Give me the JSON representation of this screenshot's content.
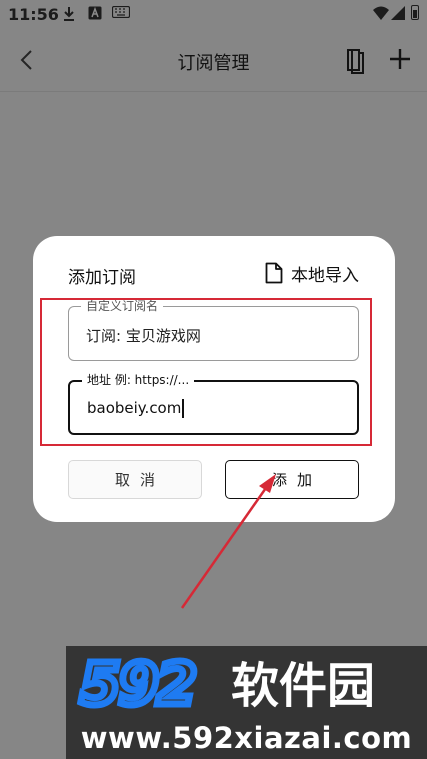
{
  "status_bar": {
    "time": "11:56",
    "icons": [
      "download-icon",
      "keyboard-a-icon",
      "keyboard-icon",
      "wifi-icon",
      "signal-icon",
      "battery-icon"
    ]
  },
  "header": {
    "title": "订阅管理",
    "icons": [
      "back-icon",
      "book-icon",
      "add-icon"
    ]
  },
  "dialog": {
    "title": "添加订阅",
    "import_label": "本地导入",
    "name_field": {
      "label": "自定义订阅名",
      "value": "订阅: 宝贝游戏网"
    },
    "url_field": {
      "label": "地址 例: https://...",
      "value": "baobeiy.com"
    },
    "cancel_label": "取消",
    "add_label": "添加"
  },
  "watermark": {
    "brand_number": "592",
    "brand_text": "软件园",
    "url": "www.592xiazai.com"
  },
  "colors": {
    "annotation_red": "#d62936",
    "watermark_blue": "#1e7bf2",
    "dialog_bg": "#ffffff"
  }
}
